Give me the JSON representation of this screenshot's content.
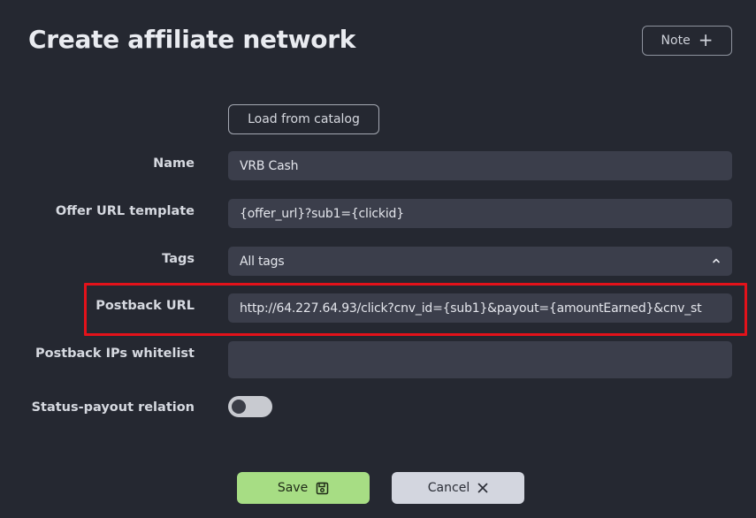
{
  "header": {
    "title": "Create affiliate network",
    "note_label": "Note",
    "note_icon": "plus-icon"
  },
  "catalog": {
    "load_label": "Load from catalog"
  },
  "form": {
    "name": {
      "label": "Name",
      "value": "VRB Cash"
    },
    "offer_url": {
      "label": "Offer URL template",
      "value": "{offer_url}?sub1={clickid}"
    },
    "tags": {
      "label": "Tags",
      "value": "All tags",
      "icon": "chevron-up-icon"
    },
    "postback_url": {
      "label": "Postback URL",
      "value": "http://64.227.64.93/click?cnv_id={sub1}&payout={amountEarned}&cnv_st",
      "highlight_color": "#e3121a"
    },
    "postback_ips": {
      "label": "Postback IPs whitelist",
      "value": ""
    },
    "status_payout": {
      "label": "Status-payout relation",
      "enabled": false
    }
  },
  "footer": {
    "save_label": "Save",
    "save_icon": "floppy-disk-icon",
    "save_color": "#a7dd84",
    "cancel_label": "Cancel",
    "cancel_icon": "close-icon",
    "cancel_color": "#d3d6df"
  }
}
